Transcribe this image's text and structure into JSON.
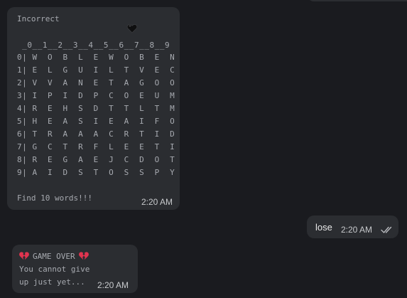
{
  "message1": {
    "status": "Incorrect",
    "emoji": "black-heart",
    "grid_header": " _0__1__2__3__4__5__6__7__8__9",
    "grid_rows": [
      "0| W  O  B  L  E  W  O  B  E  N",
      "1| E  L  G  U  I  L  T  V  E  C",
      "2| V  V  A  N  E  T  A  G  O  O",
      "3| I  P  I  D  P  C  O  E  U  M",
      "4| R  E  H  S  D  T  T  L  T  M",
      "5| H  E  A  S  I  E  A  I  F  O",
      "6| T  R  A  A  A  C  R  T  I  D",
      "7| G  C  T  R  F  L  E  E  T  I",
      "8| R  E  G  A  E  J  C  D  O  T",
      "9| A  I  D  S  T  O  S  S  P  Y"
    ],
    "footer": "Find 10 words!!!",
    "time": "2:20 AM"
  },
  "message2": {
    "text": "lose",
    "time": "2:20 AM",
    "status_icon": "double-check-icon"
  },
  "message3": {
    "title": "GAME OVER",
    "line1": "You cannot give",
    "line2": "up just yet...",
    "time": "2:20 AM",
    "emoji": "broken-heart"
  },
  "colors": {
    "background": "#1a1b1f",
    "bubble": "#2b2d31",
    "mono_text": "#a7aab0"
  }
}
